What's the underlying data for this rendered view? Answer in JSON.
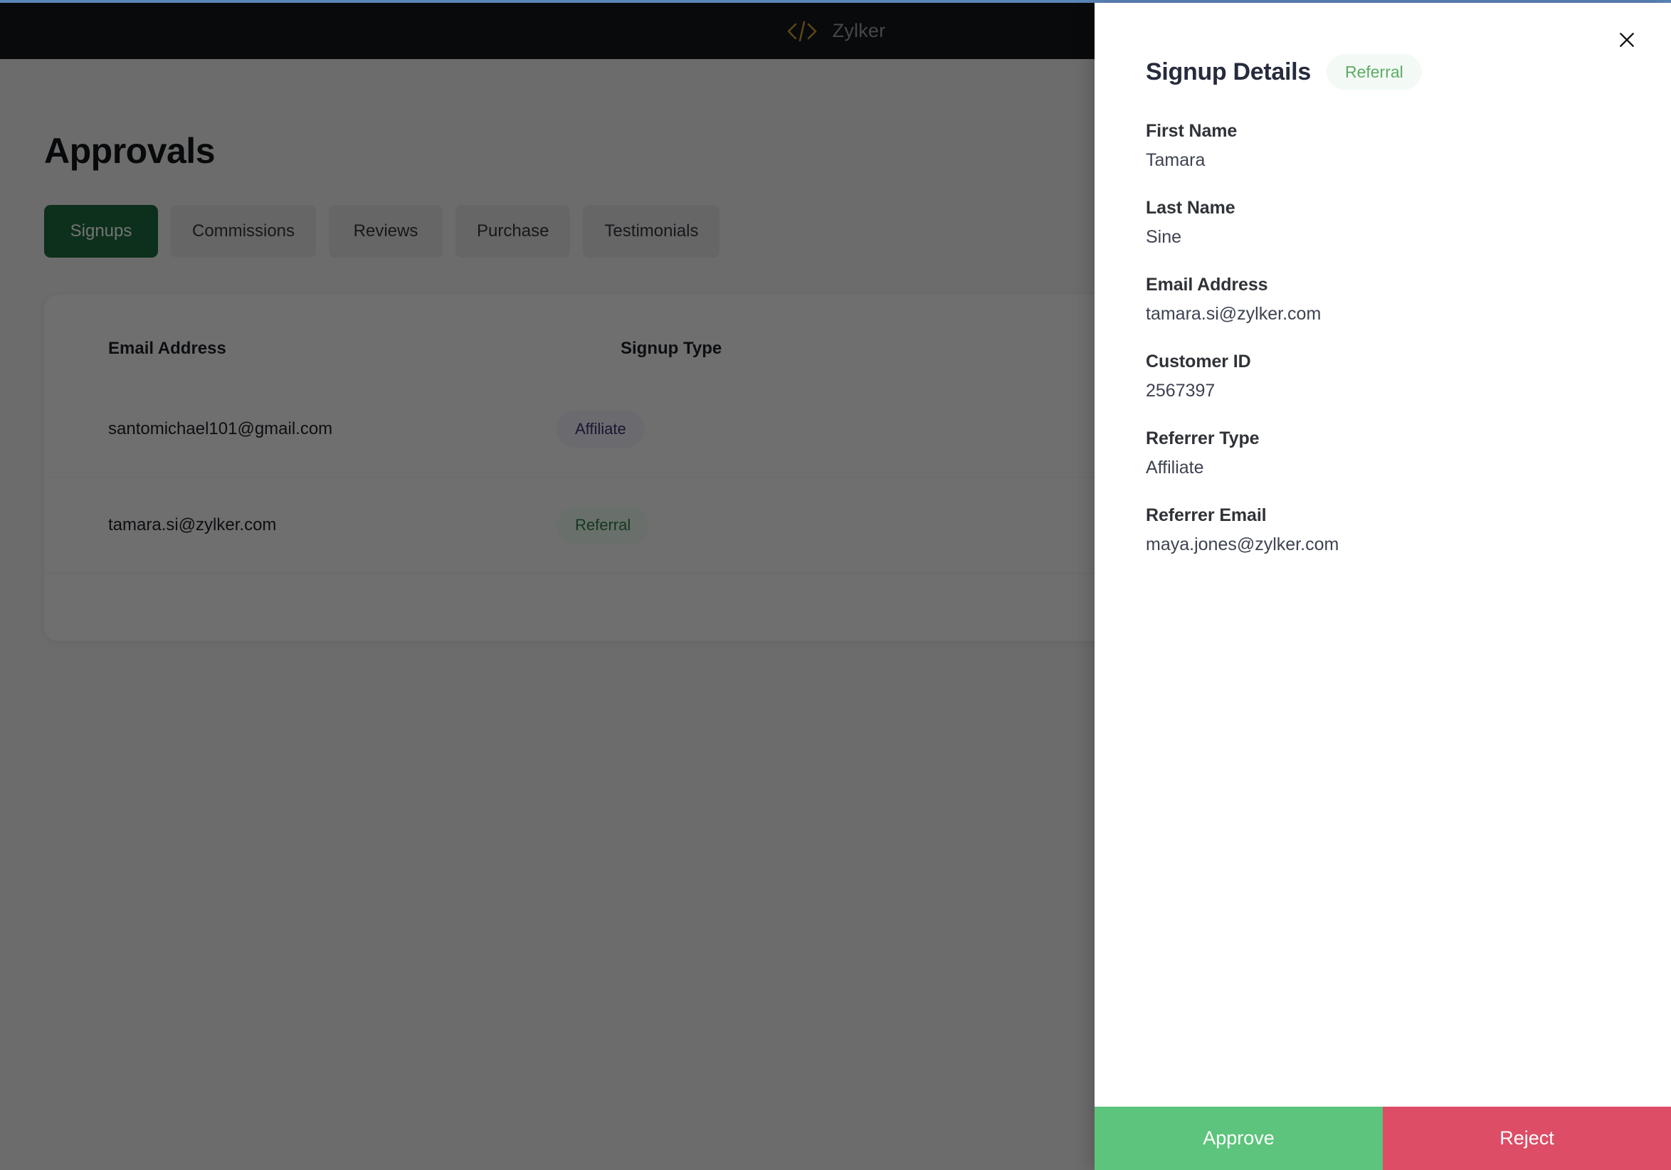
{
  "theme": {
    "browser_strip": "#5b85b8",
    "navbar_bg": "#13171c",
    "brand_accent": "#c99b2e",
    "active_tab_bg": "#1c6b3c",
    "approve_bg": "#5cc47c",
    "reject_bg": "#dd4d66",
    "badge_referral_bg": "#f3faf5",
    "badge_referral_fg": "#5cab63",
    "pill_affiliate_bg": "#edecf7",
    "pill_affiliate_fg": "#3a3470",
    "pill_referral_bg": "#e9f6ec",
    "pill_referral_fg": "#2e7d42"
  },
  "navbar": {
    "brand_name": "Zylker",
    "brand_icon": "code-brackets-icon"
  },
  "page": {
    "title": "Approvals",
    "tabs": [
      {
        "label": "Signups",
        "active": true
      },
      {
        "label": "Commissions",
        "active": false
      },
      {
        "label": "Reviews",
        "active": false
      },
      {
        "label": "Purchase",
        "active": false
      },
      {
        "label": "Testimonials",
        "active": false
      }
    ],
    "table": {
      "columns": [
        "Email Address",
        "Signup Type"
      ],
      "rows": [
        {
          "email": "santomichael101@gmail.com",
          "signup_type": "Affiliate",
          "type_style": "affiliate"
        },
        {
          "email": "tamara.si@zylker.com",
          "signup_type": "Referral",
          "type_style": "referral"
        }
      ]
    }
  },
  "panel": {
    "title": "Signup Details",
    "badge": "Referral",
    "close_icon": "close-icon",
    "fields": [
      {
        "label": "First Name",
        "value": "Tamara"
      },
      {
        "label": "Last Name",
        "value": "Sine"
      },
      {
        "label": "Email Address",
        "value": "tamara.si@zylker.com"
      },
      {
        "label": "Customer ID",
        "value": "2567397"
      },
      {
        "label": "Referrer Type",
        "value": "Affiliate"
      },
      {
        "label": "Referrer Email",
        "value": "maya.jones@zylker.com"
      }
    ],
    "footer": {
      "approve_label": "Approve",
      "reject_label": "Reject"
    }
  }
}
